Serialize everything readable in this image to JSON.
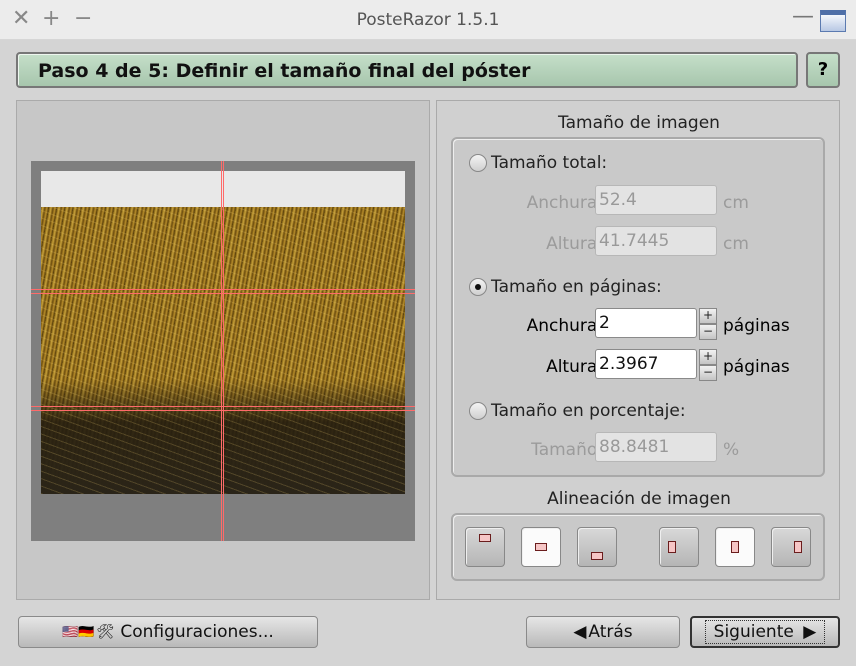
{
  "window": {
    "title": "PosteRazor 1.5.1"
  },
  "titlebar": {
    "close": "✕",
    "add": "+",
    "min": "−",
    "min2": "—"
  },
  "step": {
    "title": "Paso 4 de 5: Definir el tamaño final del póster",
    "help_label": "?"
  },
  "image_size": {
    "heading": "Tamaño de imagen",
    "total": {
      "label": "Tamaño total:",
      "selected": false,
      "width_label": "Anchura:",
      "width_value": "52.4",
      "width_unit": "cm",
      "height_label": "Altura:",
      "height_value": "41.7445",
      "height_unit": "cm"
    },
    "pages": {
      "label": "Tamaño en páginas:",
      "selected": true,
      "width_label": "Anchura:",
      "width_value": "2",
      "width_unit": "páginas",
      "height_label": "Altura:",
      "height_value": "2.3967",
      "height_unit": "páginas"
    },
    "percent": {
      "label": "Tamaño en porcentaje:",
      "selected": false,
      "size_label": "Tamaño:",
      "size_value": "88.8481",
      "size_unit": "%"
    },
    "spin_up": "+",
    "spin_down": "−"
  },
  "alignment": {
    "heading": "Alineación de imagen",
    "buttons": [
      "align-top",
      "align-vcenter",
      "align-bottom",
      "align-left",
      "align-hcenter",
      "align-right"
    ],
    "selected_vertical": "align-vcenter",
    "selected_horizontal": "align-hcenter"
  },
  "footer": {
    "settings_label": "Configuraciones...",
    "settings_flags": "🇺🇸🇩🇪",
    "settings_tool": "🛠",
    "back_label": "Atrás",
    "back_arrow": "◀",
    "next_label": "Siguiente",
    "next_arrow": "▶"
  },
  "colors": {
    "step_bar": "#b3d1b8",
    "cut_lines": "#ff6a6a",
    "paper_border": "#7f7f7f"
  }
}
